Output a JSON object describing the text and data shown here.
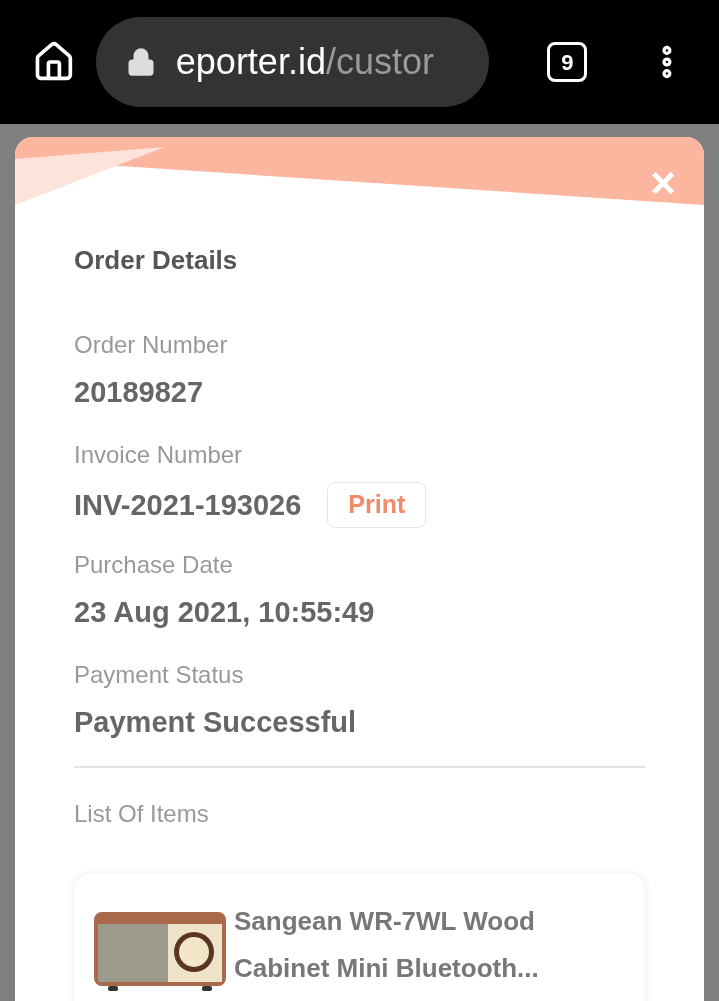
{
  "browser": {
    "url_host": "eporter.id",
    "url_path": "/custor",
    "tab_count": "9"
  },
  "modal": {
    "title": "Order Details",
    "close": "×",
    "fields": [
      {
        "label": "Order Number",
        "value": "20189827"
      },
      {
        "label": "Invoice Number",
        "value": "INV-2021-193026",
        "action": "Print"
      },
      {
        "label": "Purchase Date",
        "value": "23 Aug 2021, 10:55:49"
      },
      {
        "label": "Payment Status",
        "value": "Payment Successful"
      }
    ],
    "items_title": "List Of Items",
    "items": [
      {
        "name": "Sangean WR-7WL Wood Cabinet Mini Bluetooth...",
        "kind": "picture"
      }
    ]
  }
}
